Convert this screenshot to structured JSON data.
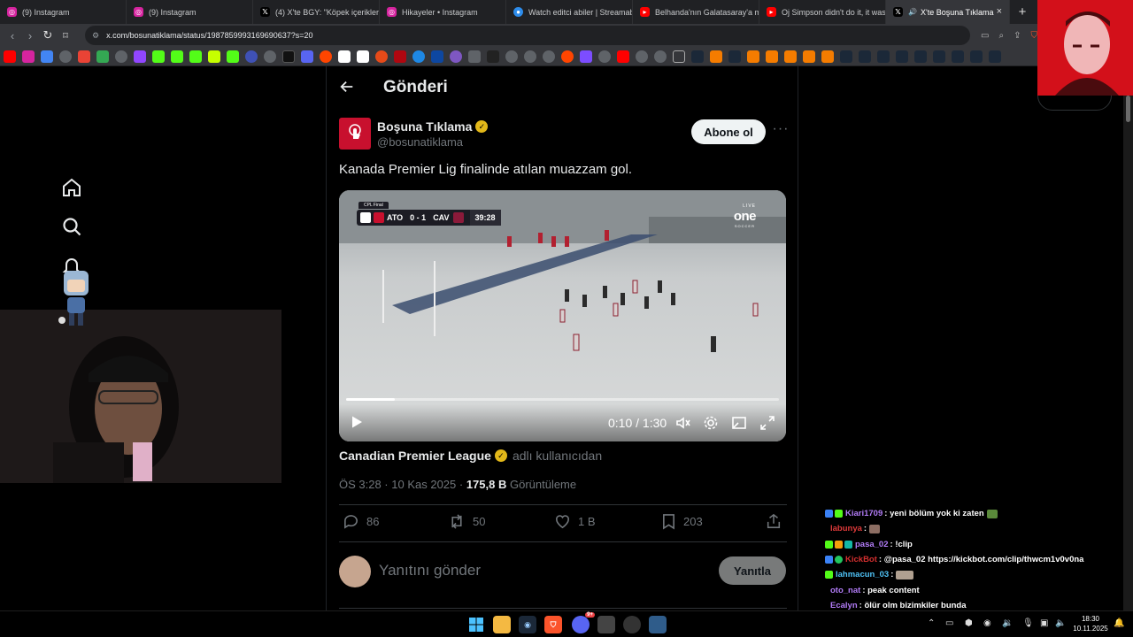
{
  "browser": {
    "tabs": [
      {
        "label": "(9) Instagram",
        "icon": "instagram-icon",
        "color": "#d6249f"
      },
      {
        "label": "(9) Instagram",
        "icon": "instagram-icon",
        "color": "#d6249f"
      },
      {
        "label": "(4) X'te BGY: \"Köpek içerikleri",
        "icon": "x-icon",
        "color": "#000000"
      },
      {
        "label": "Hikayeler • Instagram",
        "icon": "instagram-icon",
        "color": "#d6249f"
      },
      {
        "label": "Watch editci abiler | Streamabl",
        "icon": "streamable-icon",
        "color": "#2d8ceb"
      },
      {
        "label": "Belhanda'nın Galatasaray'a mal",
        "icon": "youtube-icon",
        "color": "#ff0000"
      },
      {
        "label": "Oj Simpson didn't do it, it was",
        "icon": "youtube-icon",
        "color": "#ff0000"
      },
      {
        "label": "X'te Boşuna Tıklama",
        "icon": "x-icon",
        "color": "#000000",
        "active": true
      }
    ],
    "new_tab": "+",
    "close_tab": "×",
    "url": "x.com/bosunatiklama/status/1987859993169690637?s=20"
  },
  "sidenav": {
    "items": [
      "home-icon",
      "search-icon",
      "notifications-icon"
    ]
  },
  "post": {
    "header_title": "Gönderi",
    "author": {
      "display_name": "Boşuna Tıklama",
      "handle": "@bosunatiklama",
      "verified_color": "#e2b719"
    },
    "follow_label": "Abone ol",
    "more_label": "···",
    "text": "Kanada Premier Lig finalinde atılan muazzam gol.",
    "video": {
      "scoreboard": {
        "label": "CPL Final",
        "home": "ATO",
        "score": "0 - 1",
        "away": "CAV",
        "clock": "39:28"
      },
      "broadcaster": "one",
      "broadcaster_sub": "SOCCER",
      "broadcaster_tag": "LIVE",
      "current_time": "0:10 / 1:30",
      "progress": 0.112
    },
    "attribution": {
      "source": "Canadian Premier League",
      "suffix": "adlı kullanıcıdan"
    },
    "meta": {
      "time_date": "ÖS 3:28 · 10 Kas 2025 · ",
      "views": "175,8 B",
      "views_label": " Görüntüleme"
    },
    "actions": {
      "replies": "86",
      "reposts": "50",
      "likes": "1 B",
      "bookmarks": "203"
    },
    "reply": {
      "placeholder": "Yanıtını gönder",
      "button": "Yanıtla"
    }
  },
  "chat": {
    "lines": [
      {
        "user": "Kiari1709",
        "color": "#b27cf7",
        "msg": ": yeni bölüm yok ki zaten"
      },
      {
        "user": "labunya",
        "color": "#e03a3a",
        "msg": ":"
      },
      {
        "user": "pasa_02",
        "color": "#b27cf7",
        "msg": ": !clip"
      },
      {
        "user": "KickBot",
        "color": "#d32f2f",
        "msg": ": @pasa_02 https://kickbot.com/clip/thwcm1v0v0na"
      },
      {
        "user": "lahmacun_03",
        "color": "#4fc3f7",
        "msg": ":"
      },
      {
        "user": "oto_nat",
        "color": "#b27cf7",
        "msg": ": peak content"
      },
      {
        "user": "Ecalyn",
        "color": "#b27cf7",
        "msg": ": ölür olm bizimkiler bunda"
      }
    ]
  },
  "taskbar": {
    "time": "18:30",
    "date": "10.11.2025",
    "discord_badge": "9+"
  }
}
